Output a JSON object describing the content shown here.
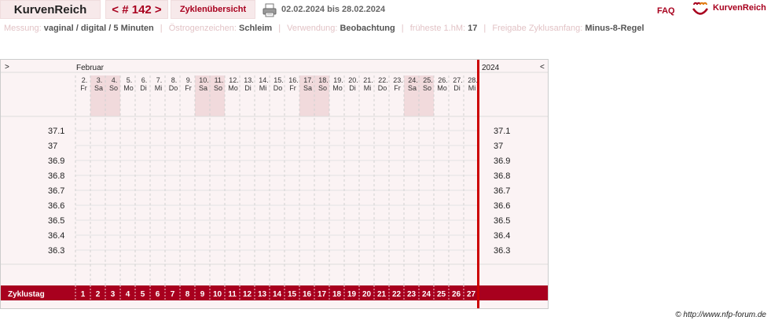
{
  "header": {
    "app_title": "KurvenReich",
    "cycle_nav": "< # 142 >",
    "overview_tab": "Zyklenübersicht",
    "print_icon": "printer-icon",
    "date_range": "02.02.2024 bis 28.02.2024",
    "faq": "FAQ",
    "logo_icon": "kurvenreich-logo-icon",
    "logo_text": "KurvenReich"
  },
  "settings": [
    {
      "label": "Messung:",
      "value": "vaginal / digital / 5 Minuten"
    },
    {
      "label": "Östrogenzeichen:",
      "value": "Schleim"
    },
    {
      "label": "Verwendung:",
      "value": "Beobachtung"
    },
    {
      "label": "früheste 1.hM:",
      "value": "17"
    },
    {
      "label": "Freigabe Zyklusanfang:",
      "value": "Minus-8-Regel"
    }
  ],
  "chart": {
    "nav_left": ">",
    "nav_right": "<",
    "month": "Februar",
    "year": "2024",
    "zyklustag_label": "Zyklustag",
    "temperature_labels": [
      "37.1",
      "37",
      "36.9",
      "36.8",
      "36.7",
      "36.6",
      "36.5",
      "36.4",
      "36.3"
    ],
    "days": [
      {
        "date": "2.",
        "wd": "Fr",
        "zt": "1",
        "weekend": false
      },
      {
        "date": "3.",
        "wd": "Sa",
        "zt": "2",
        "weekend": true
      },
      {
        "date": "4.",
        "wd": "So",
        "zt": "3",
        "weekend": true
      },
      {
        "date": "5.",
        "wd": "Mo",
        "zt": "4",
        "weekend": false
      },
      {
        "date": "6.",
        "wd": "Di",
        "zt": "5",
        "weekend": false
      },
      {
        "date": "7.",
        "wd": "Mi",
        "zt": "6",
        "weekend": false
      },
      {
        "date": "8.",
        "wd": "Do",
        "zt": "7",
        "weekend": false
      },
      {
        "date": "9.",
        "wd": "Fr",
        "zt": "8",
        "weekend": false
      },
      {
        "date": "10.",
        "wd": "Sa",
        "zt": "9",
        "weekend": true
      },
      {
        "date": "11.",
        "wd": "So",
        "zt": "10",
        "weekend": true
      },
      {
        "date": "12.",
        "wd": "Mo",
        "zt": "11",
        "weekend": false
      },
      {
        "date": "13.",
        "wd": "Di",
        "zt": "12",
        "weekend": false
      },
      {
        "date": "14.",
        "wd": "Mi",
        "zt": "13",
        "weekend": false
      },
      {
        "date": "15.",
        "wd": "Do",
        "zt": "14",
        "weekend": false
      },
      {
        "date": "16.",
        "wd": "Fr",
        "zt": "15",
        "weekend": false
      },
      {
        "date": "17.",
        "wd": "Sa",
        "zt": "16",
        "weekend": true
      },
      {
        "date": "18.",
        "wd": "So",
        "zt": "17",
        "weekend": true
      },
      {
        "date": "19.",
        "wd": "Mo",
        "zt": "18",
        "weekend": false
      },
      {
        "date": "20.",
        "wd": "Di",
        "zt": "19",
        "weekend": false
      },
      {
        "date": "21.",
        "wd": "Mi",
        "zt": "20",
        "weekend": false
      },
      {
        "date": "22.",
        "wd": "Do",
        "zt": "21",
        "weekend": false
      },
      {
        "date": "23.",
        "wd": "Fr",
        "zt": "22",
        "weekend": false
      },
      {
        "date": "24.",
        "wd": "Sa",
        "zt": "23",
        "weekend": true
      },
      {
        "date": "25.",
        "wd": "So",
        "zt": "24",
        "weekend": true
      },
      {
        "date": "26.",
        "wd": "Mo",
        "zt": "25",
        "weekend": false
      },
      {
        "date": "27.",
        "wd": "Di",
        "zt": "26",
        "weekend": false
      },
      {
        "date": "28.",
        "wd": "Mi",
        "zt": "27",
        "weekend": false
      }
    ],
    "colors": {
      "accent": "#a8001e",
      "weekend": "#f1dadc",
      "background": "#fbf3f4",
      "divider": "#cc0000"
    }
  },
  "copyright": "© http://www.nfp-forum.de"
}
